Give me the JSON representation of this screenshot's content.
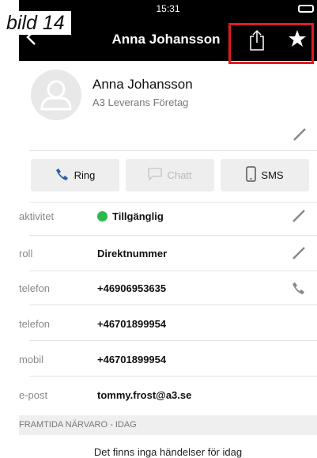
{
  "page_label": "bild 14",
  "status_bar": {
    "time": "15:31"
  },
  "nav": {
    "title": "Anna Johansson"
  },
  "contact": {
    "name": "Anna Johansson",
    "company": "A3 Leverans Företag"
  },
  "actions": {
    "call": "Ring",
    "chat": "Chatt",
    "sms": "SMS"
  },
  "details": [
    {
      "label": "aktivitet",
      "value": "Tillgänglig"
    },
    {
      "label": "roll",
      "value": "Direktnummer"
    },
    {
      "label": "telefon",
      "value": "+46906953635"
    },
    {
      "label": "telefon",
      "value": "+46701899954"
    },
    {
      "label": "mobil",
      "value": "+46701899954"
    },
    {
      "label": "e-post",
      "value": "tommy.frost@a3.se"
    }
  ],
  "section": {
    "title": "FRAMTIDA NÄRVARO - IDAG"
  },
  "empty_message": "Det finns inga händelser för idag",
  "colors": {
    "available": "#2eb84a",
    "highlight": "#e11b22",
    "bar": "#000000"
  }
}
